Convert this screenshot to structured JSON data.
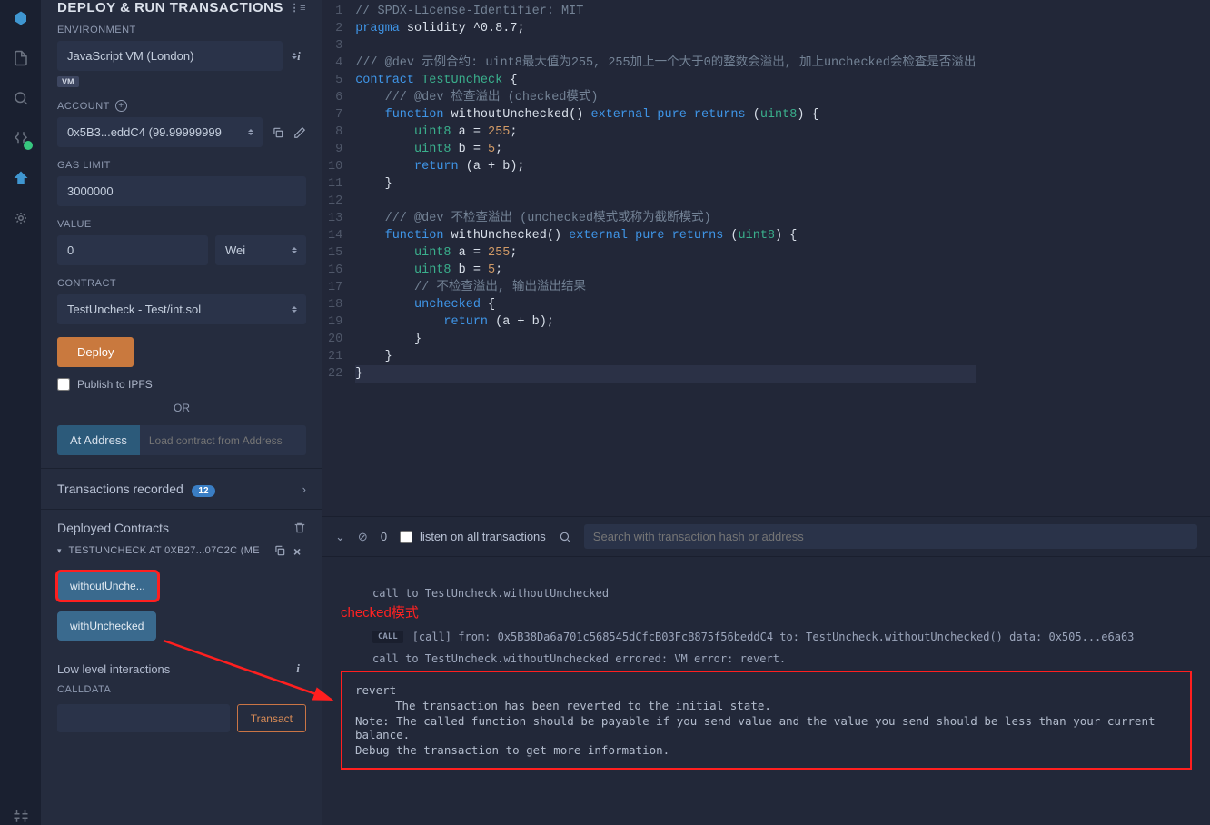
{
  "panel": {
    "title": "DEPLOY & RUN TRANSACTIONS",
    "env_label": "ENVIRONMENT",
    "env_value": "JavaScript VM (London)",
    "vm_badge": "VM",
    "account_label": "ACCOUNT",
    "account_value": "0x5B3...eddC4 (99.99999999",
    "gas_label": "GAS LIMIT",
    "gas_value": "3000000",
    "value_label": "VALUE",
    "value_amount": "0",
    "value_unit": "Wei",
    "contract_label": "CONTRACT",
    "contract_value": "TestUncheck - Test/int.sol",
    "deploy_btn": "Deploy",
    "publish_ipfs": "Publish to IPFS",
    "or": "OR",
    "ataddr": "At Address",
    "ataddr_placeholder": "Load contract from Address",
    "tx_recorded": "Transactions recorded",
    "tx_count": "12",
    "deployed_title": "Deployed Contracts",
    "deployed_item": "TESTUNCHECK AT 0XB27...07C2C (ME",
    "fn1": "withoutUnche...",
    "fn2": "withUnchecked",
    "low_level": "Low level interactions",
    "calldata_label": "CALLDATA",
    "transact": "Transact"
  },
  "code": {
    "lines": [
      [
        [
          "cmt",
          "// SPDX-License-Identifier: MIT"
        ]
      ],
      [
        [
          "kw",
          "pragma"
        ],
        [
          "ident",
          " solidity "
        ],
        [
          "str",
          "^0.8.7"
        ],
        [
          "ident",
          ";"
        ]
      ],
      [],
      [
        [
          "cmt",
          "/// @dev 示例合约: uint8最大值为255, 255加上一个大于0的整数会溢出, 加上unchecked会检查是否溢出"
        ]
      ],
      [
        [
          "kw",
          "contract"
        ],
        [
          "ident",
          " "
        ],
        [
          "type",
          "TestUncheck"
        ],
        [
          "ident",
          " {"
        ]
      ],
      [
        [
          "ident",
          "    "
        ],
        [
          "cmt",
          "/// @dev 检查溢出 (checked模式)"
        ]
      ],
      [
        [
          "ident",
          "    "
        ],
        [
          "kw",
          "function"
        ],
        [
          "ident",
          " "
        ],
        [
          "fn",
          "withoutUnchecked"
        ],
        [
          "ident",
          "() "
        ],
        [
          "kw",
          "external"
        ],
        [
          "ident",
          " "
        ],
        [
          "kw",
          "pure"
        ],
        [
          "ident",
          " "
        ],
        [
          "kw",
          "returns"
        ],
        [
          "ident",
          " ("
        ],
        [
          "type",
          "uint8"
        ],
        [
          "ident",
          ") {"
        ]
      ],
      [
        [
          "ident",
          "        "
        ],
        [
          "type",
          "uint8"
        ],
        [
          "ident",
          " a = "
        ],
        [
          "num",
          "255"
        ],
        [
          "ident",
          ";"
        ]
      ],
      [
        [
          "ident",
          "        "
        ],
        [
          "type",
          "uint8"
        ],
        [
          "ident",
          " b = "
        ],
        [
          "num",
          "5"
        ],
        [
          "ident",
          ";"
        ]
      ],
      [
        [
          "ident",
          "        "
        ],
        [
          "kw",
          "return"
        ],
        [
          "ident",
          " (a + b);"
        ]
      ],
      [
        [
          "ident",
          "    }"
        ]
      ],
      [],
      [
        [
          "ident",
          "    "
        ],
        [
          "cmt",
          "/// @dev 不检查溢出 (unchecked模式或称为截断模式)"
        ]
      ],
      [
        [
          "ident",
          "    "
        ],
        [
          "kw",
          "function"
        ],
        [
          "ident",
          " "
        ],
        [
          "fn",
          "withUnchecked"
        ],
        [
          "ident",
          "() "
        ],
        [
          "kw",
          "external"
        ],
        [
          "ident",
          " "
        ],
        [
          "kw",
          "pure"
        ],
        [
          "ident",
          " "
        ],
        [
          "kw",
          "returns"
        ],
        [
          "ident",
          " ("
        ],
        [
          "type",
          "uint8"
        ],
        [
          "ident",
          ") {"
        ]
      ],
      [
        [
          "ident",
          "        "
        ],
        [
          "type",
          "uint8"
        ],
        [
          "ident",
          " a = "
        ],
        [
          "num",
          "255"
        ],
        [
          "ident",
          ";"
        ]
      ],
      [
        [
          "ident",
          "        "
        ],
        [
          "type",
          "uint8"
        ],
        [
          "ident",
          " b = "
        ],
        [
          "num",
          "5"
        ],
        [
          "ident",
          ";"
        ]
      ],
      [
        [
          "ident",
          "        "
        ],
        [
          "cmt",
          "// 不检查溢出, 输出溢出结果"
        ]
      ],
      [
        [
          "ident",
          "        "
        ],
        [
          "kw",
          "unchecked"
        ],
        [
          "ident",
          " {"
        ]
      ],
      [
        [
          "ident",
          "            "
        ],
        [
          "kw",
          "return"
        ],
        [
          "ident",
          " (a + b);"
        ]
      ],
      [
        [
          "ident",
          "        }"
        ]
      ],
      [
        [
          "ident",
          "    }"
        ]
      ],
      [
        [
          "ident",
          "}"
        ]
      ]
    ]
  },
  "terminal": {
    "zero": "0",
    "listen_label": "listen on all transactions",
    "search_placeholder": "Search with transaction hash or address",
    "call_line": "call to TestUncheck.withoutUnchecked",
    "annotation": "checked模式",
    "call_tag": "CALL",
    "call_detail": "[call]  from: 0x5B38Da6a701c568545dCfcB03FcB875f56beddC4 to: TestUncheck.withoutUnchecked() data: 0x505...e6a63",
    "error_line": "call to TestUncheck.withoutUnchecked errored: VM error: revert.",
    "revert_title": "revert",
    "revert_msg": "The transaction has been reverted to the initial state.",
    "revert_note": "Note: The called function should be payable if you send value and the value you send should be less than your current balance.",
    "revert_debug": "Debug the transaction to get more information."
  }
}
